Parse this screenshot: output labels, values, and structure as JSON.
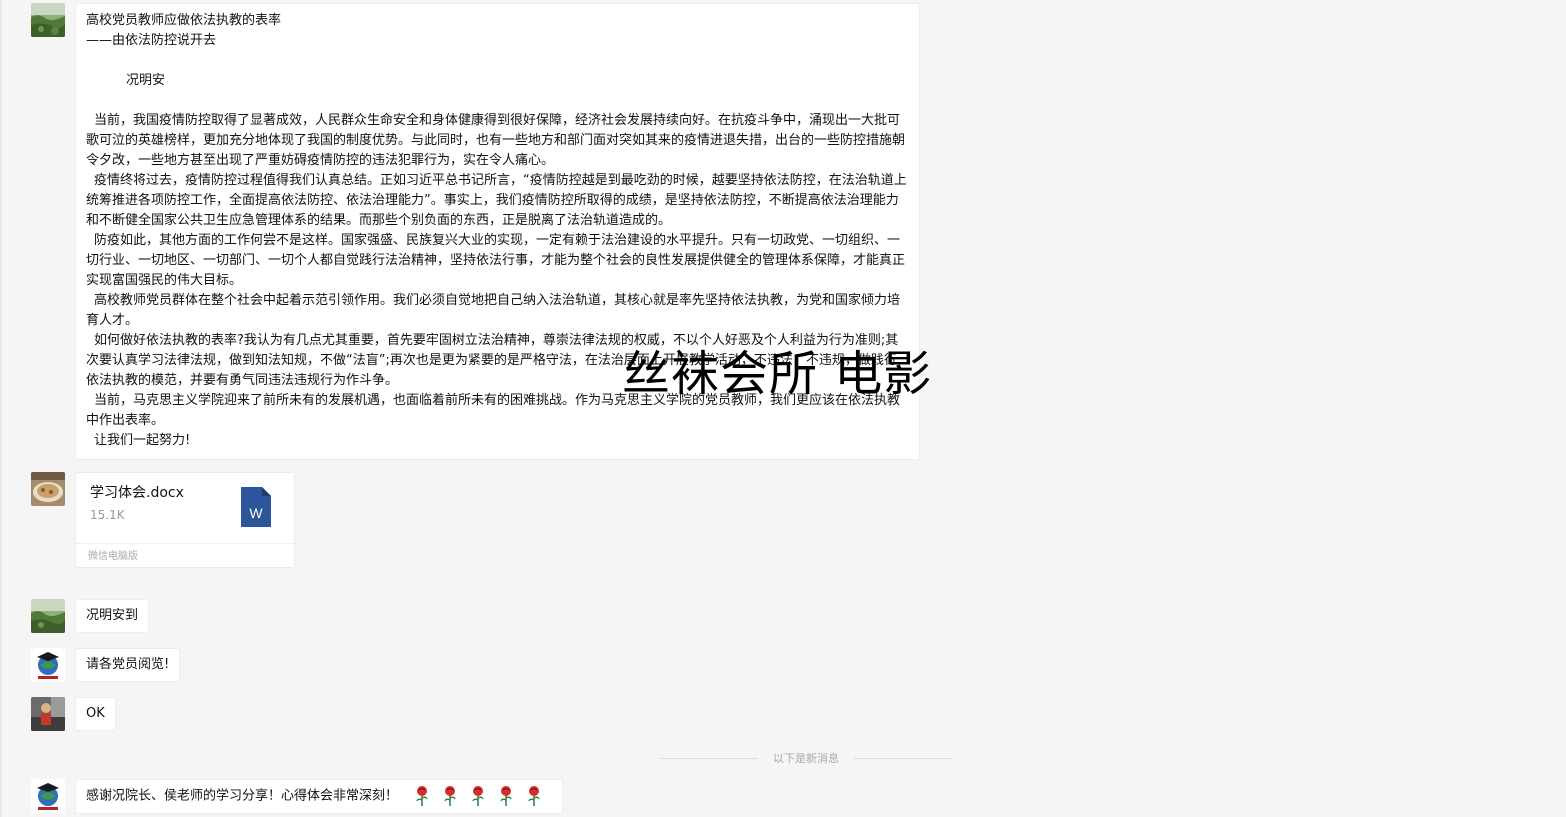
{
  "article": {
    "title": "高校党员教师应做依法执教的表率",
    "subtitle": "——由依法防控说开去",
    "author": "况明安",
    "paragraphs": [
      "当前，我国疫情防控取得了显著成效，人民群众生命安全和身体健康得到很好保障，经济社会发展持续向好。在抗疫斗争中，涌现出一大批可歌可泣的英雄榜样，更加充分地体现了我国的制度优势。与此同时，也有一些地方和部门面对突如其来的疫情进退失措，出台的一些防控措施朝令夕改，一些地方甚至出现了严重妨碍疫情防控的违法犯罪行为，实在令人痛心。",
      "疫情终将过去，疫情防控过程值得我们认真总结。正如习近平总书记所言，“疫情防控越是到最吃劲的时候，越要坚持依法防控，在法治轨道上统筹推进各项防控工作，全面提高依法防控、依法治理能力”。事实上，我们疫情防控所取得的成绩，是坚持依法防控，不断提高依法治理能力和不断健全国家公共卫生应急管理体系的结果。而那些个别负面的东西，正是脱离了法治轨道造成的。",
      "防疫如此，其他方面的工作何尝不是这样。国家强盛、民族复兴大业的实现，一定有赖于法治建设的水平提升。只有一切政党、一切组织、一切行业、一切地区、一切部门、一切个人都自觉践行法治精神，坚持依法行事，才能为整个社会的良性发展提供健全的管理体系保障，才能真正实现富国强民的伟大目标。",
      "高校教师党员群体在整个社会中起着示范引领作用。我们必须自觉地把自己纳入法治轨道，其核心就是率先坚持依法执教，为党和国家倾力培育人才。",
      "如何做好依法执教的表率?我认为有几点尤其重要，首先要牢固树立法治精神，尊崇法律法规的权威，不以个人好恶及个人利益为行为准则;其次要认真学习法律法规，做到知法知规，不做“法盲”;再次也是更为紧要的是严格守法，在法治层面上开展教学活动，不违法，不违规，做践行依法执教的模范，并要有勇气同违法违规行为作斗争。",
      "当前，马克思主义学院迎来了前所未有的发展机遇，也面临着前所未有的困难挑战。作为马克思主义学院的党员教师，我们更应该在依法执教中作出表率。",
      "让我们一起努力!"
    ]
  },
  "file": {
    "name": "学习体会.docx",
    "size": "15.1K",
    "icon_letter": "W",
    "source": "微信电脑版",
    "icon_color": "#2b579a"
  },
  "messages": [
    {
      "text": "况明安到"
    },
    {
      "text": "请各党员阅览!"
    },
    {
      "text": "OK"
    }
  ],
  "divider": {
    "text": "以下是新消息"
  },
  "last_message": {
    "text": "感谢况院长、侯老师的学习分享！心得体会非常深刻！"
  },
  "watermark": {
    "text": "丝袜会所 电影"
  },
  "colors": {
    "background": "#f5f5f5",
    "bubble": "#ffffff",
    "muted": "#999999"
  }
}
